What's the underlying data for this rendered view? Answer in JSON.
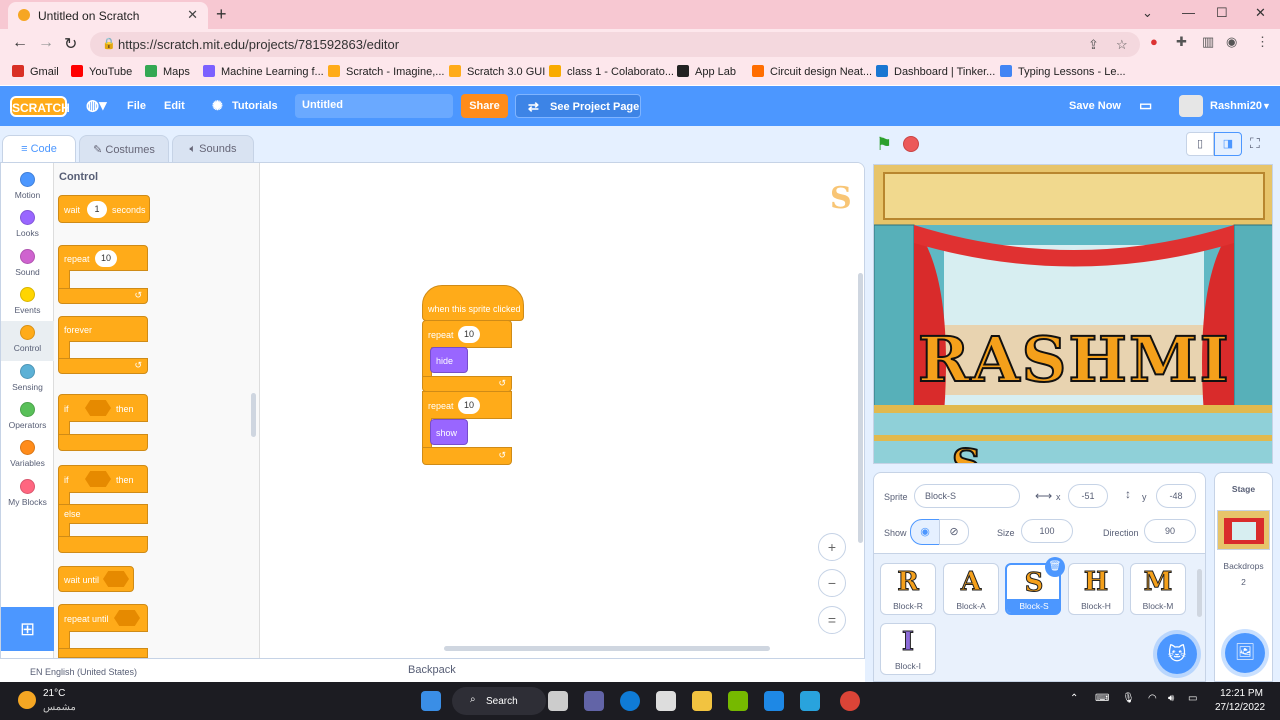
{
  "browser": {
    "tab_title": "Untitled on Scratch",
    "new_tab": "+",
    "url": "https://scratch.mit.edu/projects/781592863/editor",
    "controls": {
      "minimize": "⌄",
      "restore": "—",
      "maximize": "☐",
      "close": "✕"
    }
  },
  "bookmarks": [
    {
      "label": "Gmail",
      "color": "#d93025"
    },
    {
      "label": "YouTube",
      "color": "#ff0000"
    },
    {
      "label": "Maps",
      "color": "#34a853"
    },
    {
      "label": "Machine Learning f...",
      "color": "#7b61ff"
    },
    {
      "label": "Scratch - Imagine,...",
      "color": "#ffab19"
    },
    {
      "label": "Scratch 3.0 GUI",
      "color": "#ffab19"
    },
    {
      "label": "class 1 - Colaborato...",
      "color": "#f9ab00"
    },
    {
      "label": "App Lab",
      "color": "#222222"
    },
    {
      "label": "Circuit design Neat...",
      "color": "#ff6d00"
    },
    {
      "label": "Dashboard | Tinker...",
      "color": "#1976d2"
    },
    {
      "label": "Typing Lessons - Le...",
      "color": "#4285f4"
    }
  ],
  "menu": {
    "logo": "SCRATCH",
    "file": "File",
    "edit": "Edit",
    "tutorials": "Tutorials",
    "project_title": "Untitled",
    "share": "Share",
    "see_project": "See Project Page",
    "save_now": "Save Now",
    "username": "Rashmi20"
  },
  "editor_tabs": {
    "code": "Code",
    "costumes": "Costumes",
    "sounds": "Sounds"
  },
  "categories": [
    {
      "label": "Motion",
      "color": "#4c97ff"
    },
    {
      "label": "Looks",
      "color": "#9966ff"
    },
    {
      "label": "Sound",
      "color": "#cf63cf"
    },
    {
      "label": "Events",
      "color": "#ffd500"
    },
    {
      "label": "Control",
      "color": "#ffab19"
    },
    {
      "label": "Sensing",
      "color": "#5cb1d6"
    },
    {
      "label": "Operators",
      "color": "#59c059"
    },
    {
      "label": "Variables",
      "color": "#ff8c1a"
    },
    {
      "label": "My Blocks",
      "color": "#ff6680"
    }
  ],
  "palette": {
    "heading": "Control",
    "wait": "wait",
    "wait_value": "1",
    "seconds": "seconds",
    "repeat": "repeat",
    "repeat_value": "10",
    "forever": "forever",
    "if": "if",
    "then": "then",
    "else": "else",
    "wait_until": "wait until",
    "repeat_until": "repeat until"
  },
  "script": {
    "hat": "when this sprite clicked",
    "repeat1": "repeat",
    "repeat1_value": "10",
    "hide": "hide",
    "repeat2": "repeat",
    "repeat2_value": "10",
    "show": "show"
  },
  "zoom": {
    "in": "+",
    "out": "−",
    "reset": "="
  },
  "backpack": "Backpack",
  "language": "EN English (United States)",
  "stage_text": "RASHMI",
  "sprite_info": {
    "sprite_label": "Sprite",
    "sprite_name": "Block-S",
    "x_label": "x",
    "x_value": "-51",
    "y_label": "y",
    "y_value": "-48",
    "show_label": "Show",
    "size_label": "Size",
    "size_value": "100",
    "direction_label": "Direction",
    "direction_value": "90"
  },
  "sprites": [
    {
      "glyph": "R",
      "name": "Block-R"
    },
    {
      "glyph": "A",
      "name": "Block-A"
    },
    {
      "glyph": "S",
      "name": "Block-S"
    },
    {
      "glyph": "H",
      "name": "Block-H"
    },
    {
      "glyph": "M",
      "name": "Block-M"
    },
    {
      "glyph": "I",
      "name": "Block-I"
    }
  ],
  "stage_panel": {
    "title": "Stage",
    "backdrops_label": "Backdrops",
    "backdrops_count": "2"
  },
  "taskbar": {
    "temp": "21°C",
    "weather": "مشمس",
    "search": "Search",
    "time": "12:21 PM",
    "date": "27/12/2022"
  }
}
